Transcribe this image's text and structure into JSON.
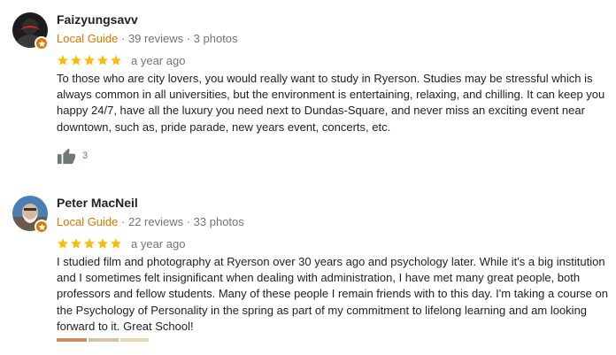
{
  "reviews": [
    {
      "author": "Faizyungsavv",
      "badge": "Local Guide",
      "reviews_count": "39 reviews",
      "photos_count": "3 photos",
      "separator": " · ",
      "rating": 5,
      "age": "a year ago",
      "text": "To those who are city lovers, you would really want to study in Ryerson. Studies may be stressful which is always common in all universities, but the environment is entertaining, relaxing, and chilling. It can keep you happy 24/7, have all the luxury you need next to Dundas-Square, and never miss an exciting event near downtown, such as, pride parade, new years event, concerts, etc.",
      "likes": "3",
      "icons": {
        "avatar": "avatar-dark",
        "badge": "local-guide-star-icon",
        "like": "thumbs-up-icon"
      }
    },
    {
      "author": "Peter MacNeil",
      "badge": "Local Guide",
      "reviews_count": "22 reviews",
      "photos_count": "33 photos",
      "separator": " · ",
      "rating": 5,
      "age": "a year ago",
      "text": "I studied film and photography at Ryerson over 30 years ago and psychology later. While it's a big institution and I sometimes felt insignificant when dealing with administration, I have met many great people, both professors and fellow students. Many of these people I remain friends with to this day. I'm taking a course on the Psychology of Personality in the spring as part of my commitment to lifelong learning and am looking forward to it. Great School!",
      "icons": {
        "avatar": "avatar-photo",
        "badge": "local-guide-star-icon"
      }
    }
  ],
  "colors": {
    "star": "#fbbc04",
    "guide": "#e37400",
    "meta": "#70757a",
    "text": "#222222"
  }
}
